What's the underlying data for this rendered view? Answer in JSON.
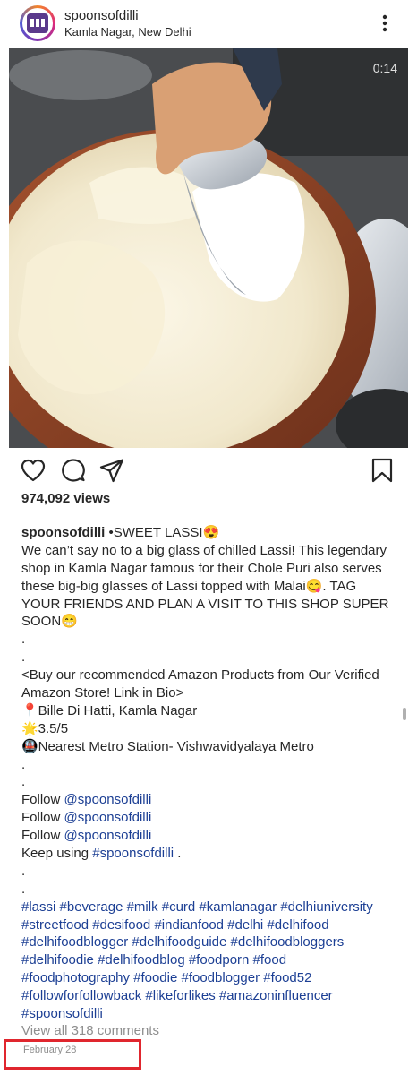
{
  "header": {
    "username": "spoonsofdilli",
    "location": "Kamla Nagar, New Delhi"
  },
  "media": {
    "timer": "0:14",
    "icon": "lassi-video-thumbnail"
  },
  "actions": {
    "like_icon": "heart-icon",
    "comment_icon": "comment-icon",
    "share_icon": "send-icon",
    "save_icon": "bookmark-icon"
  },
  "views_text": "974,092 views",
  "caption": {
    "username": "spoonsofdilli",
    "lines": [
      {
        "kind": "first",
        "text": " •SWEET LASSI😍"
      },
      {
        "kind": "text",
        "text": "We can’t say no to a big glass of chilled Lassi! This legendary"
      },
      {
        "kind": "text",
        "text": "shop in Kamla Nagar famous for their Chole Puri also serves"
      },
      {
        "kind": "text",
        "text": "these big-big glasses of Lassi topped with Malai😋. TAG"
      },
      {
        "kind": "text",
        "text": "YOUR FRIENDS AND PLAN A VISIT TO THIS SHOP SUPER"
      },
      {
        "kind": "text",
        "text": "SOON😁"
      },
      {
        "kind": "text",
        "text": "."
      },
      {
        "kind": "text",
        "text": "."
      },
      {
        "kind": "text",
        "text": "<Buy our recommended Amazon Products from Our Verified"
      },
      {
        "kind": "text",
        "text": "Amazon Store! Link in Bio>"
      },
      {
        "kind": "text",
        "text": "📍Bille Di Hatti, Kamla Nagar"
      },
      {
        "kind": "text",
        "text": "🌟3.5/5"
      },
      {
        "kind": "text",
        "text": "🚇Nearest Metro Station- Vishwavidyalaya Metro"
      },
      {
        "kind": "text",
        "text": "."
      },
      {
        "kind": "text",
        "text": "."
      },
      {
        "kind": "follow",
        "prefix": "Follow ",
        "link": "@spoonsofdilli"
      },
      {
        "kind": "follow",
        "prefix": "Follow ",
        "link": "@spoonsofdilli"
      },
      {
        "kind": "follow",
        "prefix": "Follow ",
        "link": "@spoonsofdilli"
      },
      {
        "kind": "using",
        "prefix": "Keep using ",
        "link": "#spoonsofdilli",
        "suffix": " ."
      },
      {
        "kind": "text",
        "text": "."
      },
      {
        "kind": "text",
        "text": "."
      },
      {
        "kind": "tags",
        "text": "#lassi #beverage #milk #curd #kamlanagar #delhiuniversity"
      },
      {
        "kind": "tags",
        "text": "#streetfood #desifood #indianfood #delhi #delhifood"
      },
      {
        "kind": "tags",
        "text": "#delhifoodblogger #delhifoodguide #delhifoodbloggers"
      },
      {
        "kind": "tags",
        "text": "#delhifoodie #delhifoodblog #foodporn #food"
      },
      {
        "kind": "tags",
        "text": "#foodphotography #foodie #foodblogger #food52"
      },
      {
        "kind": "tags",
        "text": "#followforfollowback #likeforlikes #amazoninfluencer"
      },
      {
        "kind": "tags",
        "text": "#spoonsofdilli"
      }
    ]
  },
  "view_comments": "View all 318 comments",
  "date": "February 28",
  "colors": {
    "link": "#1c3f94",
    "muted": "#8e8e8e",
    "highlight": "#e0262e"
  }
}
